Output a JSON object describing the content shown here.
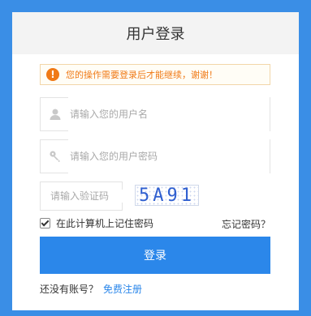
{
  "header": {
    "title": "用户登录"
  },
  "warning": {
    "icon": "exclamation-icon",
    "text": "您的操作需要登录后才能继续，谢谢！"
  },
  "form": {
    "username_placeholder": "请输入您的用户名",
    "password_placeholder": "请输入您的用户密码",
    "captcha_placeholder": "请输入验证码",
    "captcha_text": "5A91",
    "remember_label": "在此计算机上记住密码",
    "remember_checked": true,
    "forgot_label": "忘记密码？",
    "login_label": "登录"
  },
  "signup": {
    "prompt": "还没有账号？",
    "link_label": "免费注册"
  },
  "colors": {
    "background": "#3a8ee6",
    "accent": "#2b87ea",
    "warning": "#f07a17"
  }
}
